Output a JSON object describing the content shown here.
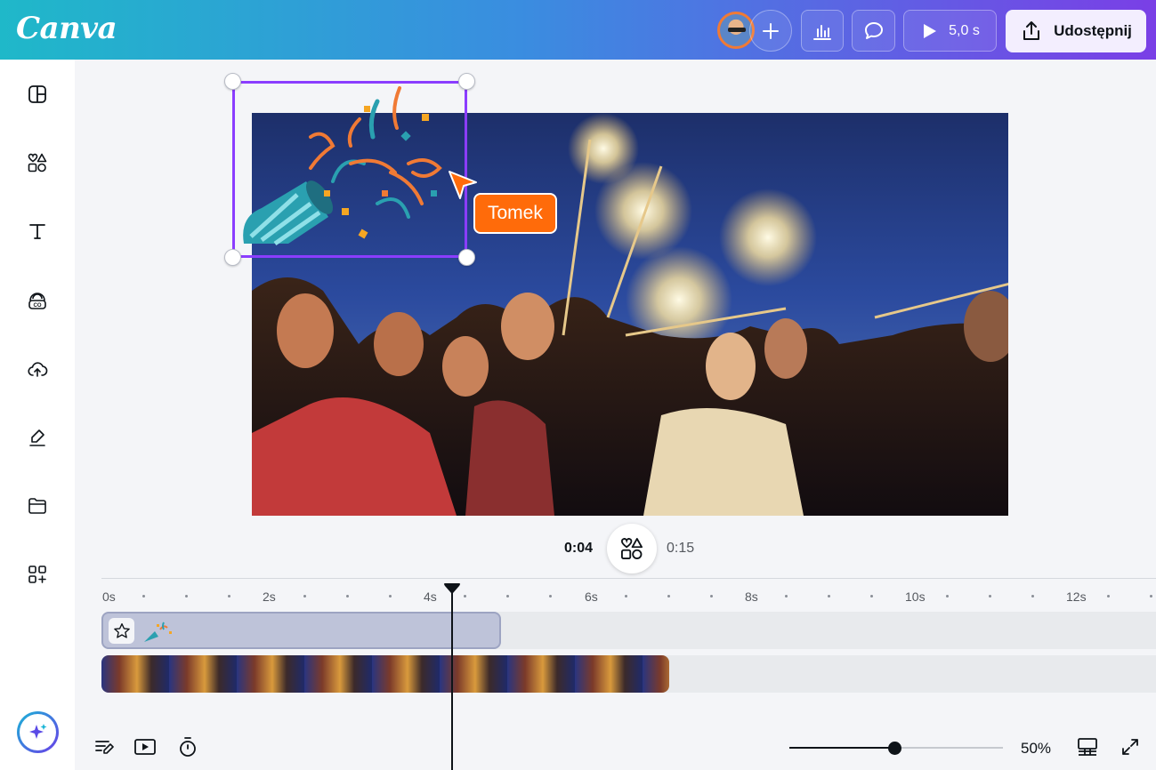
{
  "app": {
    "logo": "Canva"
  },
  "header": {
    "play_duration": "5,0 s",
    "share_label": "Udostępnij"
  },
  "sidebar": {
    "items": [
      {
        "icon": "layout-icon"
      },
      {
        "icon": "elements-icon"
      },
      {
        "icon": "text-icon"
      },
      {
        "icon": "brand-icon"
      },
      {
        "icon": "uploads-icon"
      },
      {
        "icon": "draw-icon"
      },
      {
        "icon": "projects-icon"
      },
      {
        "icon": "apps-icon"
      }
    ]
  },
  "canvas": {
    "collaborator_name": "Tomek"
  },
  "playback": {
    "current_time": "0:04",
    "total_time": "0:15"
  },
  "timeline": {
    "ticks": [
      "0s",
      "2s",
      "4s",
      "6s",
      "8s",
      "10s",
      "12s"
    ]
  },
  "footer": {
    "zoom_level": "50%",
    "zoom_fraction": 0.49
  },
  "colors": {
    "accent": "#8b3dff",
    "collaborator": "#ff6b0a"
  }
}
